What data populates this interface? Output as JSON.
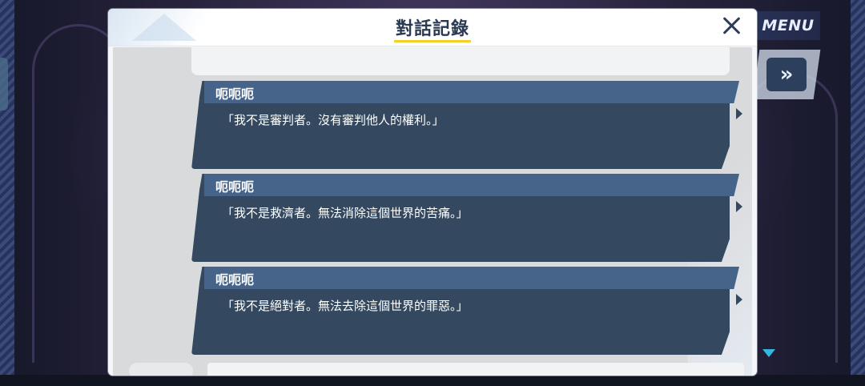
{
  "dialog": {
    "title": "對話記錄"
  },
  "entries": [
    {
      "speaker": "呃呃呃",
      "text": "「我不是審判者。沒有審判他人的權利。」"
    },
    {
      "speaker": "呃呃呃",
      "text": "「我不是救濟者。無法消除這個世界的苦痛。」"
    },
    {
      "speaker": "呃呃呃",
      "text": "「我不是絕對者。無法去除這個世界的罪惡。」"
    }
  ],
  "hud": {
    "menu_label": "MENU",
    "skip_glyph": "»"
  },
  "icons": {
    "close": "close-icon",
    "skip": "fast-forward-icon",
    "scroll": "triangle-down-icon"
  },
  "colors": {
    "entry_body": "#34495f",
    "entry_header": "#46648a",
    "title_accent": "#f2d22a"
  }
}
